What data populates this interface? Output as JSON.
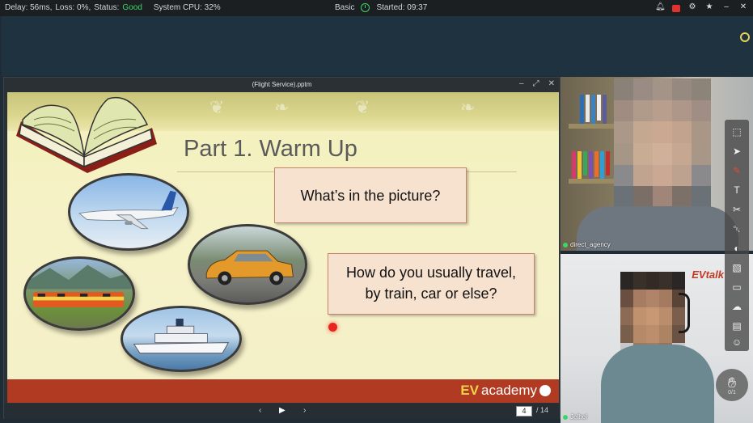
{
  "status_bar": {
    "delay": "Delay: 56ms,",
    "loss": "Loss: 0%,",
    "status_label": "Status:",
    "status_value": "Good",
    "cpu": "System CPU: 32%",
    "mode": "Basic",
    "started": "Started: 09:37",
    "good_color": "#3fd46a"
  },
  "presentation": {
    "window_title": "(Flight Service).pptm",
    "slide": {
      "heading": "Part 1. Warm Up",
      "question_1": "What’s in the picture?",
      "question_2_line1": "How do you usually travel,",
      "question_2_line2": "by train, car or else?",
      "logo_ev": "EV",
      "logo_text": "academy"
    },
    "navigation": {
      "current_page": "4",
      "total_pages": "/ 14"
    }
  },
  "participants": [
    {
      "name": "direct_agency"
    },
    {
      "name": "Jelhel",
      "badge": "EVtalk"
    }
  ],
  "hand_raise": {
    "count": "0/1"
  },
  "icons": [
    "clock-icon",
    "bell-icon",
    "record-icon",
    "gear-icon",
    "pin-icon",
    "minimize-icon",
    "close-icon",
    "hand-raise-icon"
  ],
  "accent_colors": {
    "slide_footer": "#b03a22",
    "pointer": "#e7261f",
    "ring": "#e6d15a"
  }
}
